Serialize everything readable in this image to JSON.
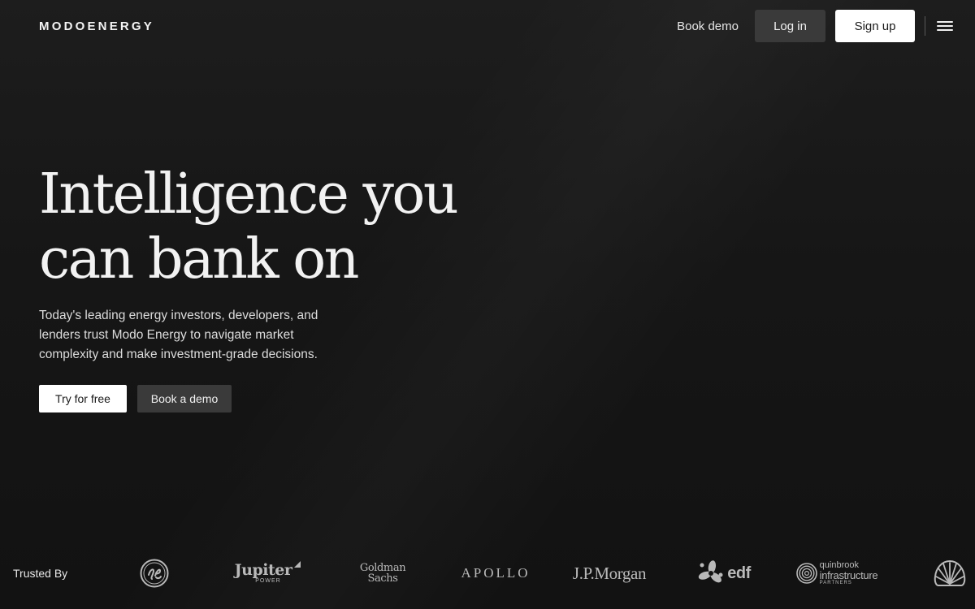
{
  "header": {
    "brand": "MODOENERGY",
    "book_demo": "Book demo",
    "login": "Log in",
    "signup": "Sign up"
  },
  "hero": {
    "title_line1": "Intelligence you",
    "title_line2": "can bank on",
    "description": "Today's leading energy investors, developers, and lenders trust Modo Energy to navigate market complexity and make investment-grade decisions.",
    "cta_primary": "Try for free",
    "cta_secondary": "Book a demo"
  },
  "trusted": {
    "label": "Trusted By",
    "logos": {
      "ge": "GE",
      "jupiter": "Jupiter",
      "jupiter_sub": "POWER",
      "goldman_1": "Goldman",
      "goldman_2": "Sachs",
      "apollo": "APOLLO",
      "jpmorgan": "J.P.Morgan",
      "edf": "edf",
      "quinbrook_1": "quinbrook",
      "quinbrook_2": "infrastructure",
      "quinbrook_3": "PARTNERS",
      "shell": "Shell"
    }
  },
  "icons": [
    "menu-icon",
    "ge-logo",
    "jupiter-logo-mark",
    "edf-logo-mark",
    "quinbrook-logo-mark",
    "shell-logo"
  ],
  "colors": {
    "background": "#161616",
    "text": "#f2f2f2",
    "button_light": "#ffffff",
    "button_dark": "#3a3a3a",
    "logo_gray": "#b9b9b9"
  }
}
